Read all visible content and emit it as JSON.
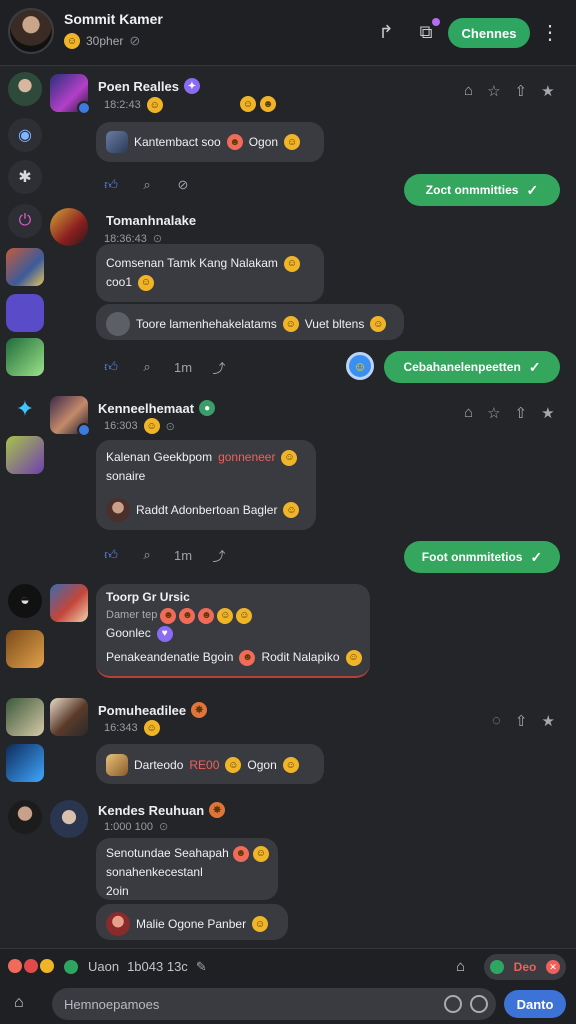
{
  "header": {
    "name": "Sommit Kamer",
    "status": "30pher",
    "channels_button": "Chennes"
  },
  "messages": [
    {
      "name": "Poen Realles",
      "time": "18:2:43",
      "body": "Kantembact soo",
      "tail": "Ogon"
    },
    {
      "name": "Tomanhnalake",
      "time": "18:36:43",
      "line1": "Comsenan Tamk Kang Nalakam",
      "line2": "coo1",
      "quote": "Toore lamenhehakelatams",
      "quote_tail": "Vuet bltens"
    },
    {
      "name": "Kenneelhemaat",
      "time": "16:303",
      "line1": "Kalenan Geekbpom",
      "line1_red": "gonneneer",
      "line2": "sonaire",
      "quote": "Raddt Adonbertoan Bagler"
    },
    {
      "name": "Toorp Gr Ursic",
      "time": "Damer tep",
      "line2": "Goonlec",
      "body": "Penakeandenatie Bgoin",
      "tail": "Rodit Nalapiko"
    },
    {
      "name": "Pomuheadilee",
      "time": "16:343",
      "body": "Darteodo",
      "body_red": "RE00",
      "tail": "Ogon"
    },
    {
      "name": "Kendes Reuhuan",
      "time": "1:000 100",
      "line1": "Senotundae Seahapah",
      "line2": "sonahenkecestanl",
      "line3": "2oin",
      "quote": "Malie Ogone Panber"
    }
  ],
  "reactions": {
    "row1_count": "",
    "row2_count": "1m",
    "row3_count": "1m"
  },
  "outgoing": {
    "pill1": "Zoct onmmitties",
    "pill2": "Cebahanelenpeetten",
    "pill3": "Foot onmmitetios"
  },
  "status_strip": {
    "text_a": "Uaon",
    "text_b": "1b043 13c",
    "draft_label": "Deo"
  },
  "composer": {
    "placeholder": "Hemnoepamoes",
    "send": "Danto"
  },
  "colors": {
    "accent_green": "#35a65e",
    "accent_blue": "#3d73d6",
    "background": "#232529",
    "bubble": "#393b41"
  }
}
